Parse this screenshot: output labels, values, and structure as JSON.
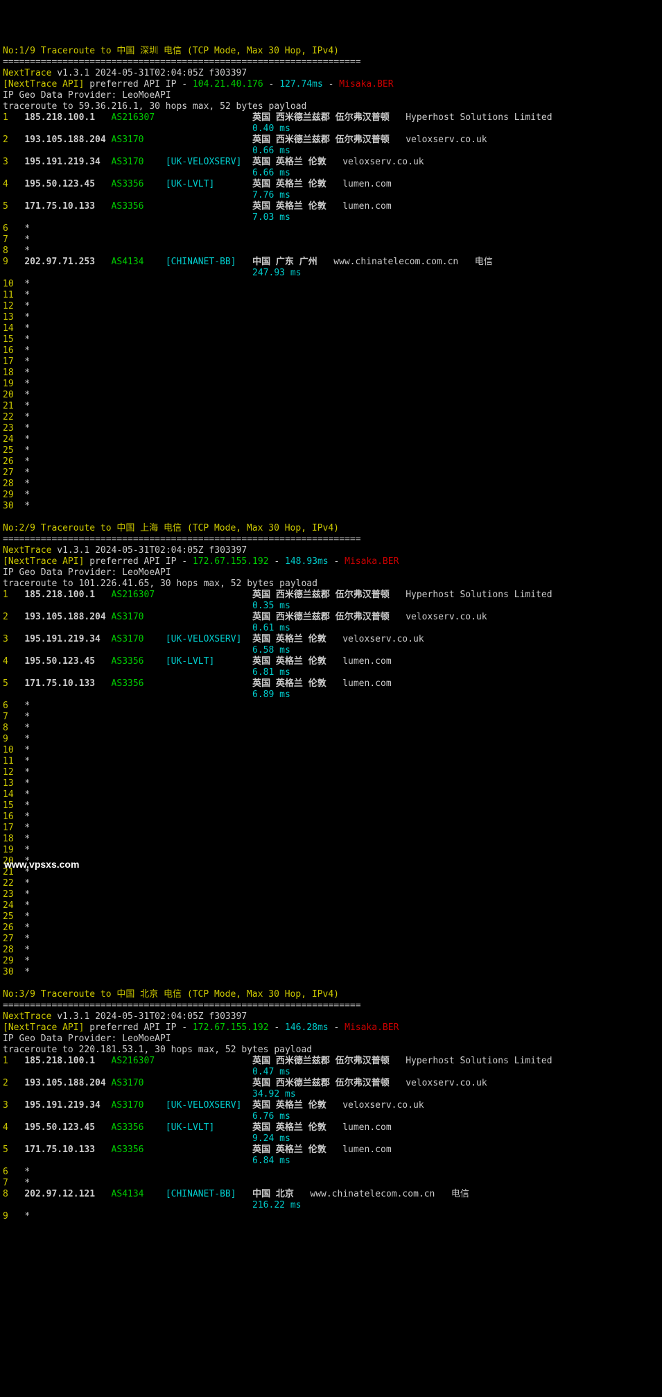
{
  "watermark": "www.vpsxs.com",
  "sep": "==================================================================",
  "blocks": [
    {
      "header": "No:1/9 Traceroute to 中国 深圳 电信 (TCP Mode, Max 30 Hop, IPv4)",
      "nt_label": "NextTrace",
      "nt_ver": "v1.3.1 2024-05-31T02:04:05Z f303397",
      "api_prefix": "[NextTrace API]",
      "api_text": " preferred API IP - ",
      "api_ip": "104.21.40.176",
      "api_dash": " - ",
      "api_rtt": "127.74ms",
      "api_dash2": " - ",
      "api_node": "Misaka.BER",
      "provider": "IP Geo Data Provider: LeoMoeAPI",
      "target": "traceroute to 59.36.216.1, 30 hops max, 52 bytes payload",
      "hops": [
        {
          "n": "1",
          "ip": "185.218.100.1",
          "asn": "AS216307",
          "net": "",
          "loc": "英国 西米德兰兹郡 伍尔弗汉普顿",
          "host": "Hyperhost Solutions Limited",
          "tag": "",
          "rtt": "0.40 ms"
        },
        {
          "n": "2",
          "ip": "193.105.188.204",
          "asn": "AS3170",
          "net": "",
          "loc": "英国 西米德兰兹郡 伍尔弗汉普顿",
          "host": "veloxserv.co.uk",
          "tag": "",
          "rtt": "0.66 ms"
        },
        {
          "n": "3",
          "ip": "195.191.219.34",
          "asn": "AS3170",
          "net": "[UK-VELOXSERV]",
          "loc": "英国 英格兰 伦敦",
          "host": "veloxserv.co.uk",
          "tag": "",
          "rtt": "6.66 ms"
        },
        {
          "n": "4",
          "ip": "195.50.123.45",
          "asn": "AS3356",
          "net": "[UK-LVLT]",
          "loc": "英国 英格兰 伦敦",
          "host": "lumen.com",
          "tag": "",
          "rtt": "7.76 ms"
        },
        {
          "n": "5",
          "ip": "171.75.10.133",
          "asn": "AS3356",
          "net": "",
          "loc": "英国 英格兰 伦敦",
          "host": "lumen.com",
          "tag": "",
          "rtt": "7.03 ms"
        },
        {
          "n": "6",
          "star": true
        },
        {
          "n": "7",
          "star": true
        },
        {
          "n": "8",
          "star": true
        },
        {
          "n": "9",
          "ip": "202.97.71.253",
          "asn": "AS4134",
          "net": "[CHINANET-BB]",
          "loc": "中国 广东 广州",
          "host": "www.chinatelecom.com.cn",
          "tag": "电信",
          "rtt": "247.93 ms"
        },
        {
          "n": "10",
          "star": true
        },
        {
          "n": "11",
          "star": true
        },
        {
          "n": "12",
          "star": true
        },
        {
          "n": "13",
          "star": true
        },
        {
          "n": "14",
          "star": true
        },
        {
          "n": "15",
          "star": true
        },
        {
          "n": "16",
          "star": true
        },
        {
          "n": "17",
          "star": true
        },
        {
          "n": "18",
          "star": true
        },
        {
          "n": "19",
          "star": true
        },
        {
          "n": "20",
          "star": true
        },
        {
          "n": "21",
          "star": true
        },
        {
          "n": "22",
          "star": true
        },
        {
          "n": "23",
          "star": true
        },
        {
          "n": "24",
          "star": true
        },
        {
          "n": "25",
          "star": true
        },
        {
          "n": "26",
          "star": true
        },
        {
          "n": "27",
          "star": true
        },
        {
          "n": "28",
          "star": true
        },
        {
          "n": "29",
          "star": true
        },
        {
          "n": "30",
          "star": true
        }
      ]
    },
    {
      "header": "No:2/9 Traceroute to 中国 上海 电信 (TCP Mode, Max 30 Hop, IPv4)",
      "nt_label": "NextTrace",
      "nt_ver": "v1.3.1 2024-05-31T02:04:05Z f303397",
      "api_prefix": "[NextTrace API]",
      "api_text": " preferred API IP - ",
      "api_ip": "172.67.155.192",
      "api_dash": " - ",
      "api_rtt": "148.93ms",
      "api_dash2": " - ",
      "api_node": "Misaka.BER",
      "provider": "IP Geo Data Provider: LeoMoeAPI",
      "target": "traceroute to 101.226.41.65, 30 hops max, 52 bytes payload",
      "hops": [
        {
          "n": "1",
          "ip": "185.218.100.1",
          "asn": "AS216307",
          "net": "",
          "loc": "英国 西米德兰兹郡 伍尔弗汉普顿",
          "host": "Hyperhost Solutions Limited",
          "tag": "",
          "rtt": "0.35 ms"
        },
        {
          "n": "2",
          "ip": "193.105.188.204",
          "asn": "AS3170",
          "net": "",
          "loc": "英国 西米德兰兹郡 伍尔弗汉普顿",
          "host": "veloxserv.co.uk",
          "tag": "",
          "rtt": "0.61 ms"
        },
        {
          "n": "3",
          "ip": "195.191.219.34",
          "asn": "AS3170",
          "net": "[UK-VELOXSERV]",
          "loc": "英国 英格兰 伦敦",
          "host": "veloxserv.co.uk",
          "tag": "",
          "rtt": "6.58 ms"
        },
        {
          "n": "4",
          "ip": "195.50.123.45",
          "asn": "AS3356",
          "net": "[UK-LVLT]",
          "loc": "英国 英格兰 伦敦",
          "host": "lumen.com",
          "tag": "",
          "rtt": "6.81 ms"
        },
        {
          "n": "5",
          "ip": "171.75.10.133",
          "asn": "AS3356",
          "net": "",
          "loc": "英国 英格兰 伦敦",
          "host": "lumen.com",
          "tag": "",
          "rtt": "6.89 ms"
        },
        {
          "n": "6",
          "star": true
        },
        {
          "n": "7",
          "star": true
        },
        {
          "n": "8",
          "star": true
        },
        {
          "n": "9",
          "star": true
        },
        {
          "n": "10",
          "star": true
        },
        {
          "n": "11",
          "star": true
        },
        {
          "n": "12",
          "star": true
        },
        {
          "n": "13",
          "star": true
        },
        {
          "n": "14",
          "star": true
        },
        {
          "n": "15",
          "star": true
        },
        {
          "n": "16",
          "star": true
        },
        {
          "n": "17",
          "star": true
        },
        {
          "n": "18",
          "star": true
        },
        {
          "n": "19",
          "star": true
        },
        {
          "n": "20",
          "star": true
        },
        {
          "n": "21",
          "star": true
        },
        {
          "n": "22",
          "star": true
        },
        {
          "n": "23",
          "star": true
        },
        {
          "n": "24",
          "star": true
        },
        {
          "n": "25",
          "star": true
        },
        {
          "n": "26",
          "star": true
        },
        {
          "n": "27",
          "star": true
        },
        {
          "n": "28",
          "star": true
        },
        {
          "n": "29",
          "star": true
        },
        {
          "n": "30",
          "star": true
        }
      ]
    },
    {
      "header": "No:3/9 Traceroute to 中国 北京 电信 (TCP Mode, Max 30 Hop, IPv4)",
      "nt_label": "NextTrace",
      "nt_ver": "v1.3.1 2024-05-31T02:04:05Z f303397",
      "api_prefix": "[NextTrace API]",
      "api_text": " preferred API IP - ",
      "api_ip": "172.67.155.192",
      "api_dash": " - ",
      "api_rtt": "146.28ms",
      "api_dash2": " - ",
      "api_node": "Misaka.BER",
      "provider": "IP Geo Data Provider: LeoMoeAPI",
      "target": "traceroute to 220.181.53.1, 30 hops max, 52 bytes payload",
      "hops": [
        {
          "n": "1",
          "ip": "185.218.100.1",
          "asn": "AS216307",
          "net": "",
          "loc": "英国 西米德兰兹郡 伍尔弗汉普顿",
          "host": "Hyperhost Solutions Limited",
          "tag": "",
          "rtt": "0.47 ms"
        },
        {
          "n": "2",
          "ip": "193.105.188.204",
          "asn": "AS3170",
          "net": "",
          "loc": "英国 西米德兰兹郡 伍尔弗汉普顿",
          "host": "veloxserv.co.uk",
          "tag": "",
          "rtt": "34.92 ms"
        },
        {
          "n": "3",
          "ip": "195.191.219.34",
          "asn": "AS3170",
          "net": "[UK-VELOXSERV]",
          "loc": "英国 英格兰 伦敦",
          "host": "veloxserv.co.uk",
          "tag": "",
          "rtt": "6.76 ms"
        },
        {
          "n": "4",
          "ip": "195.50.123.45",
          "asn": "AS3356",
          "net": "[UK-LVLT]",
          "loc": "英国 英格兰 伦敦",
          "host": "lumen.com",
          "tag": "",
          "rtt": "9.24 ms"
        },
        {
          "n": "5",
          "ip": "171.75.10.133",
          "asn": "AS3356",
          "net": "",
          "loc": "英国 英格兰 伦敦",
          "host": "lumen.com",
          "tag": "",
          "rtt": "6.84 ms"
        },
        {
          "n": "6",
          "star": true
        },
        {
          "n": "7",
          "star": true
        },
        {
          "n": "8",
          "ip": "202.97.12.121",
          "asn": "AS4134",
          "net": "[CHINANET-BB]",
          "loc": "中国 北京",
          "host": "www.chinatelecom.com.cn",
          "tag": "电信",
          "rtt": "216.22 ms"
        },
        {
          "n": "9",
          "star": true
        }
      ],
      "truncated": true
    }
  ]
}
